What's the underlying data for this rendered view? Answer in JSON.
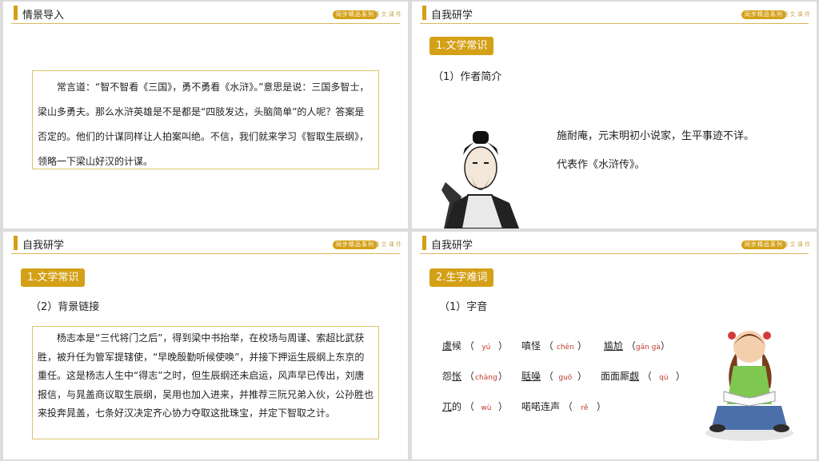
{
  "brand_badge": "同步精品系列",
  "brand_sub": "语 文 课 件",
  "slide1": {
    "title": "情景导入",
    "paragraph": "常言道：“智不智看《三国》，勇不勇看《水浒》。”意思是说：三国多智士，梁山多勇夫。那么水浒英雄是不是都是“四肢发达，头脑简单”的人呢？答案是否定的。他们的计谋同样让人拍案叫绝。不信，我们就来学习《智取生辰纲》，领略一下梁山好汉的计谋。"
  },
  "slide2": {
    "title": "自我研学",
    "tag": "1.文学常识",
    "subtitle": "（1）作者简介",
    "line1": "施耐庵，元末明初小说家，生平事迹不详。",
    "line2": "代表作《水浒传》。"
  },
  "slide3": {
    "title": "自我研学",
    "tag": "1.文学常识",
    "subtitle": "（2）背景链接",
    "paragraph": "杨志本是“三代将门之后”，得到梁中书抬举，在校场与周谨、索超比武获胜，被升任为管军提辖使，“早晚殷勤听候使唤”，并接下押运生辰纲上东京的重任。这是杨志人生中“得志”之时，但生辰纲还未启运，风声早已传出，刘唐报信，与晁盖商议取生辰纲，吴用也加入进来，并推荐三阮兄弟入伙，公孙胜也来投奔晁盖，七条好汉决定齐心协力夺取这批珠宝，并定下智取之计。"
  },
  "slide4": {
    "title": "自我研学",
    "tag": "2.生字难词",
    "subtitle": "（1）字音",
    "items": [
      {
        "w1": "虞",
        "w2": "候",
        "py": "yú"
      },
      {
        "w1": "嗔怪",
        "w2": "",
        "py": "chēn"
      },
      {
        "w1": "尴尬",
        "w2": "",
        "py": "gān gà"
      },
      {
        "w1": "怨",
        "w2": "怅",
        "py": "chàng"
      },
      {
        "w1": "聒噪",
        "w2": "",
        "py": "guō"
      },
      {
        "w1": "面面厮",
        "w2": "觑",
        "py": "qù"
      },
      {
        "w1": "兀",
        "w2": "的",
        "py": "wù"
      },
      {
        "w1": "喏喏连声",
        "w2": "",
        "py": "rě"
      }
    ]
  }
}
